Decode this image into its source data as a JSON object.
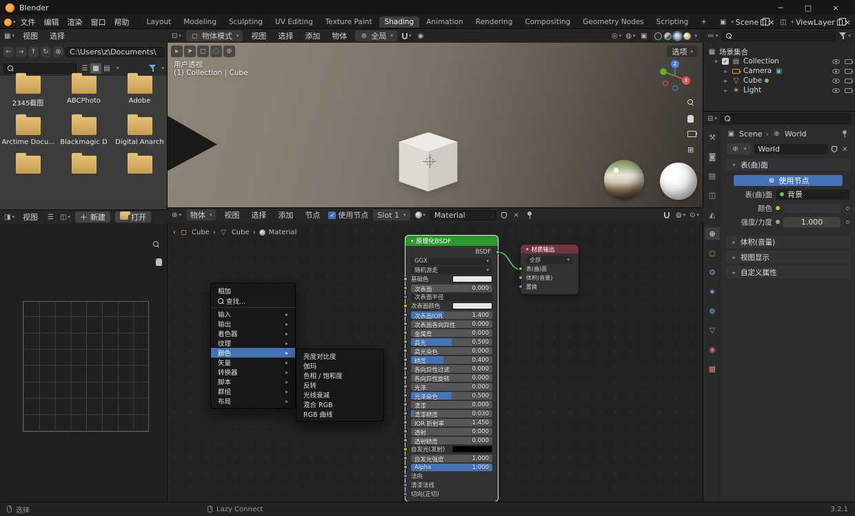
{
  "colors": {
    "accent": "#4772b3",
    "noodle": "#63c763",
    "bsdf_header": "#2e9732",
    "output_header": "#73333f",
    "folder": "#d9b368",
    "world_color_swatch": "#34383d"
  },
  "titlebar": {
    "title": "Blender"
  },
  "topbar": {
    "menus": [
      "文件",
      "编辑",
      "渲染",
      "窗口",
      "帮助"
    ],
    "tabs": [
      "Layout",
      "Modeling",
      "Sculpting",
      "UV Editing",
      "Texture Paint",
      "Shading",
      "Animation",
      "Rendering",
      "Compositing",
      "Geometry Nodes",
      "Scripting"
    ],
    "scene": "Scene",
    "viewlayer": "ViewLayer"
  },
  "file_browser": {
    "menu_view": "视图",
    "menu_select": "选择",
    "path": "C:\\Users\\z\\Documents\\",
    "folders": [
      "2345截图",
      "ABCPhoto",
      "Adobe",
      "Arctime Docu...",
      "Blackmagic D",
      "Digital Anarch"
    ]
  },
  "viewport": {
    "mode": "物体模式",
    "menu_view": "视图",
    "menu_select": "选择",
    "menu_add": "添加",
    "menu_object": "物体",
    "orientation": "全局",
    "options": "选项",
    "overlay_line1": "用户透视",
    "overlay_line2": "(1) Collection | Cube",
    "axis_z": "Z",
    "axis_x": "X"
  },
  "image_editor": {
    "menu_view": "视图",
    "new_button": "新建",
    "open_button": "打开"
  },
  "shader_editor": {
    "mode": "物体",
    "menu_view": "视图",
    "menu_select": "选择",
    "menu_add": "添加",
    "menu_node": "节点",
    "use_nodes": "使用节点",
    "slot": "Slot 1",
    "material": "Material",
    "breadcrumb": [
      "Cube",
      "Cube",
      "Material"
    ]
  },
  "add_menu": {
    "title": "相加",
    "search": "查找...",
    "items": [
      "输入",
      "输出",
      "着色器",
      "纹理",
      "颜色",
      "矢量",
      "转换器",
      "脚本",
      "群组",
      "布局"
    ],
    "submenu": [
      "亮度对比度",
      "伽玛",
      "色相 / 饱和度",
      "反转",
      "光线衰减",
      "混合 RGB",
      "RGB 曲线"
    ]
  },
  "bsdf_node": {
    "title": "原理化BSDF",
    "output": "BSDF",
    "distribution": "GGX",
    "method": "随机游走",
    "rows": [
      {
        "label": "基础色",
        "swatch": "#e7e7e7"
      },
      {
        "label": "次表面",
        "value": "0.000"
      },
      {
        "label": "次表面半径"
      },
      {
        "label": "次表面颜色",
        "swatch": "#e7e7e7"
      },
      {
        "label": "次表面IOR",
        "value": "1.400"
      },
      {
        "label": "次表面各向异性",
        "value": "0.000"
      },
      {
        "label": "金属度",
        "value": "0.000"
      },
      {
        "label": "高光",
        "value": "0.500"
      },
      {
        "label": "高光染色",
        "value": "0.000"
      },
      {
        "label": "糙度",
        "value": "0.400"
      },
      {
        "label": "各向异性过滤",
        "value": "0.000"
      },
      {
        "label": "各向异性旋转",
        "value": "0.000"
      },
      {
        "label": "光泽",
        "value": "0.000"
      },
      {
        "label": "光泽染色",
        "value": "0.500"
      },
      {
        "label": "清漆",
        "value": "0.000"
      },
      {
        "label": "清漆糙度",
        "value": "0.030"
      },
      {
        "label": "IOR 折射率",
        "value": "1.450"
      },
      {
        "label": "透射",
        "value": "0.000"
      },
      {
        "label": "透射糙度",
        "value": "0.000"
      },
      {
        "label": "自发光(发射)",
        "swatch": "#000000"
      },
      {
        "label": "自发光强度",
        "value": "1.000"
      },
      {
        "label": "Alpha",
        "value": "1.000"
      },
      {
        "label": "法向"
      },
      {
        "label": "清漆法线"
      },
      {
        "label": "切向(正切)"
      }
    ]
  },
  "output_node": {
    "title": "材质输出",
    "target": "全部",
    "inputs": [
      "表(曲)面",
      "体积(音量)",
      "置换"
    ]
  },
  "outliner": {
    "rows": [
      {
        "label": "场景集合"
      },
      {
        "label": "Collection"
      },
      {
        "label": "Camera"
      },
      {
        "label": "Cube"
      },
      {
        "label": "Light"
      }
    ]
  },
  "properties": {
    "tabs": [
      {
        "name": "tool",
        "glyph": "⚒"
      },
      {
        "name": "render",
        "glyph": "◙"
      },
      {
        "name": "output",
        "glyph": "▤"
      },
      {
        "name": "view-layer",
        "glyph": "◫"
      },
      {
        "name": "scene",
        "glyph": "◭"
      },
      {
        "name": "world",
        "glyph": "⊕"
      },
      {
        "name": "object",
        "glyph": "◻"
      },
      {
        "name": "modifiers",
        "glyph": "⚙"
      },
      {
        "name": "particles",
        "glyph": "∗"
      },
      {
        "name": "physics",
        "glyph": "⊚"
      },
      {
        "name": "object-data",
        "glyph": "▽"
      },
      {
        "name": "material",
        "glyph": "◉"
      },
      {
        "name": "texture",
        "glyph": "▦"
      }
    ],
    "breadcrumb_scene": "Scene",
    "breadcrumb_world": "World",
    "world_name": "World",
    "surface_section": "表(曲)面",
    "use_nodes_button": "使用节点",
    "surface_label": "表(曲)面",
    "surface_value": "背景",
    "color_label": "颜色",
    "strength_label": "强度/力度",
    "strength_value": "1.000",
    "volume_section": "体积(音量)",
    "viewport_display_section": "视图显示",
    "custom_props_section": "自定义属性"
  },
  "statusbar": {
    "select": "选择",
    "hint": "Lazy Connect",
    "version": "3.2.1"
  }
}
